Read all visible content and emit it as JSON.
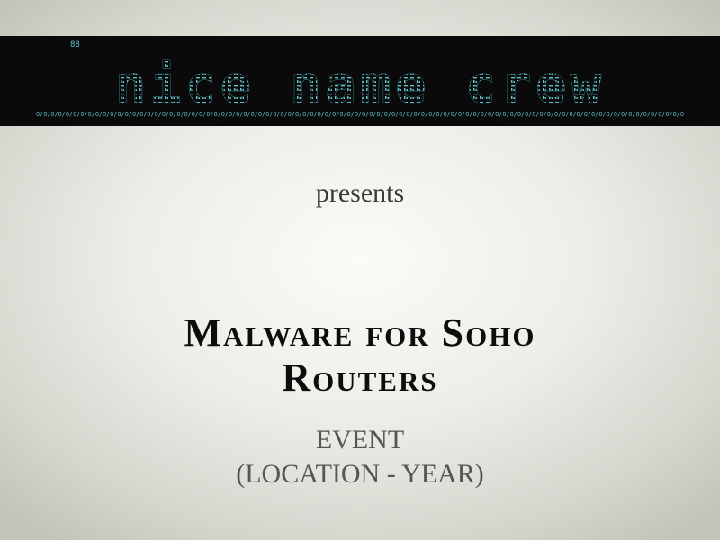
{
  "slide": {
    "logo_text": "nice name crew",
    "banner_color": "#5fc0c8",
    "presents": "presents",
    "title_line1": "Malware for Soho",
    "title_line2": "Routers",
    "event_line1": "EVENT",
    "event_line2": "(LOCATION - YEAR)"
  }
}
